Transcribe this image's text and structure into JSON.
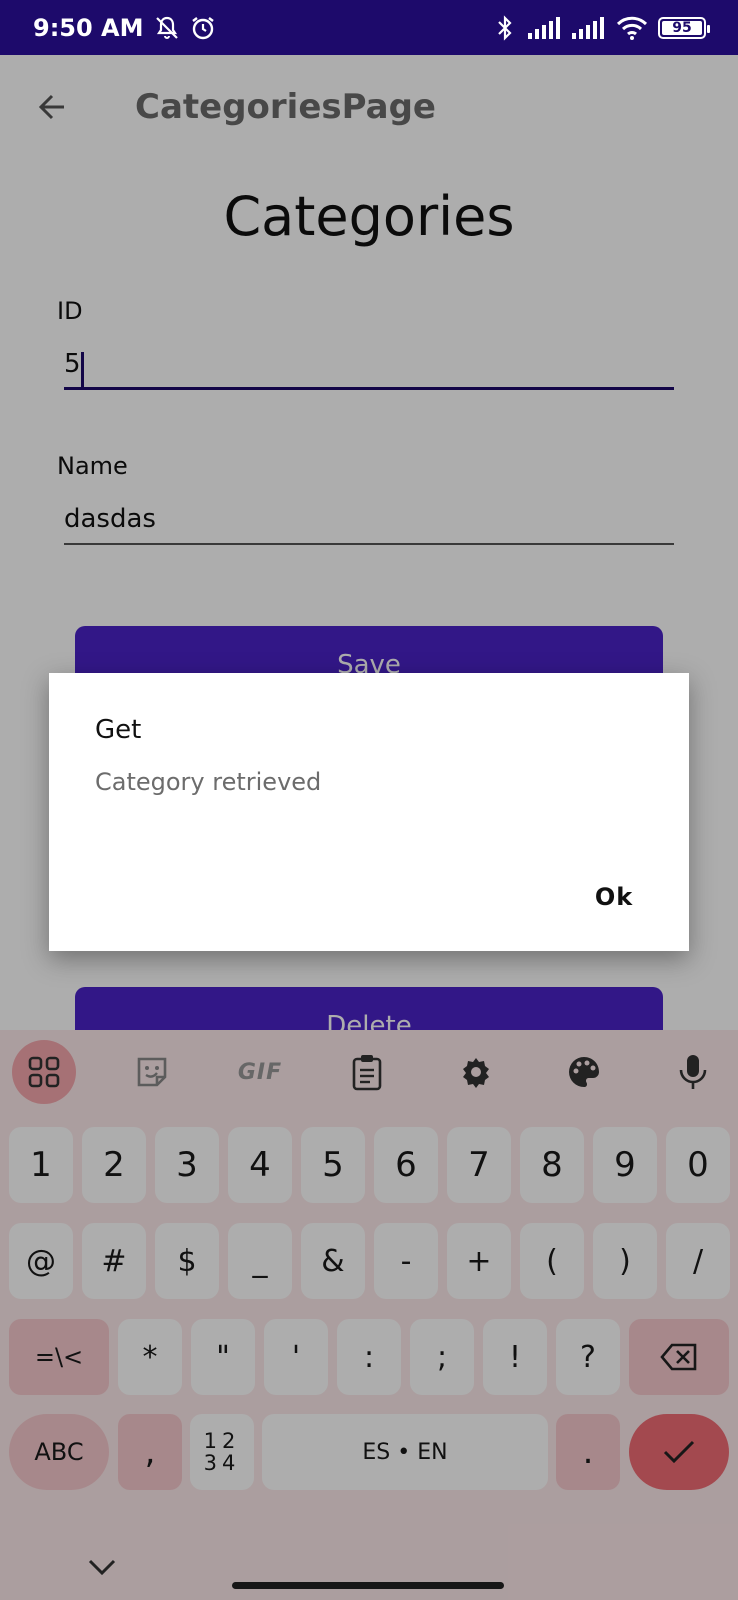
{
  "status_bar": {
    "time": "9:50 AM",
    "battery": "95"
  },
  "app_bar": {
    "title": "CategoriesPage"
  },
  "page": {
    "heading": "Categories",
    "fields": {
      "id_label": "ID",
      "id_value": "5",
      "name_label": "Name",
      "name_value": "dasdas"
    },
    "buttons": {
      "save": "Save",
      "delete": "Delete"
    }
  },
  "dialog": {
    "title": "Get",
    "message": "Category retrieved",
    "ok_label": "Ok"
  },
  "keyboard": {
    "toolbar_icons": [
      "apps-grid-icon",
      "sticker-icon",
      "gif-icon",
      "clipboard-icon",
      "settings-gear-icon",
      "palette-icon",
      "microphone-icon"
    ],
    "gif_label": "GIF",
    "row1": [
      "1",
      "2",
      "3",
      "4",
      "5",
      "6",
      "7",
      "8",
      "9",
      "0"
    ],
    "row2": [
      "@",
      "#",
      "$",
      "_",
      "&",
      "-",
      "+",
      "(",
      ")",
      "/"
    ],
    "row3": [
      "=\\<",
      "*",
      "\"",
      "'",
      ":",
      ";",
      "!",
      "?"
    ],
    "row4": {
      "abc": "ABC",
      "comma": ",",
      "numpad_top": "12",
      "numpad_bottom": "34",
      "space": "ES • EN",
      "period": "."
    }
  },
  "colors": {
    "status_bar": "#1d0a6b",
    "primary_button": "#4a23c7",
    "keyboard_bg": "#fde9ea",
    "enter_key": "#f16c75"
  }
}
